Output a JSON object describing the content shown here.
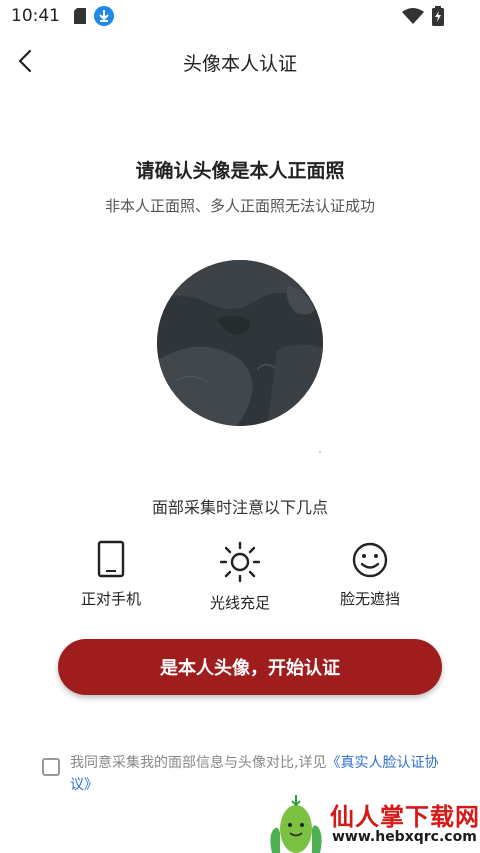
{
  "status_bar": {
    "time": "10:41"
  },
  "nav": {
    "title": "头像本人认证"
  },
  "heading": "请确认头像是本人正面照",
  "subheading": "非本人正面照、多人正面照无法认证成功",
  "tips": {
    "title": "面部采集时注意以下几点",
    "items": [
      {
        "label": "正对手机",
        "icon": "phone-icon"
      },
      {
        "label": "光线充足",
        "icon": "sun-icon"
      },
      {
        "label": "脸无遮挡",
        "icon": "smile-icon"
      }
    ]
  },
  "start_button": "是本人头像，开始认证",
  "agreement": {
    "prefix": "我同意采集我的面部信息与头像对比,详见",
    "link": "《真实人脸认证协议》"
  },
  "watermark": {
    "title": "仙人掌下载网",
    "url": "www.hebxqrc.com"
  },
  "colors": {
    "primary_button": "#a01d1d",
    "link": "#2f6fd1",
    "watermark": "#d51818"
  }
}
